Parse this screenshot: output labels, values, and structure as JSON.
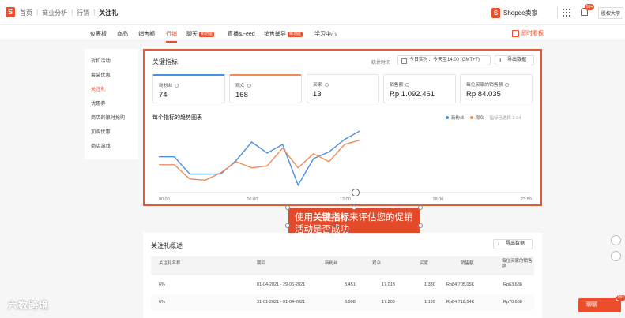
{
  "header": {
    "logo": "S",
    "breadcrumbs": [
      "首页",
      "商业分析",
      "行销",
      "关注礼"
    ],
    "brand": "Shopee卖家",
    "bell_badge": "99+",
    "user": "股权大学"
  },
  "nav": {
    "tabs": [
      {
        "label": "仪表板"
      },
      {
        "label": "商品"
      },
      {
        "label": "销售额"
      },
      {
        "label": "行销"
      },
      {
        "label": "聊天",
        "tag": "新功能"
      },
      {
        "label": "直播&Feed"
      },
      {
        "label": "销售辅导",
        "tag": "新功能"
      },
      {
        "label": "学习中心"
      }
    ],
    "promo_link": "即时看板"
  },
  "sidebar": {
    "items": [
      "折扣活动",
      "套装优惠",
      "关注礼",
      "优惠券",
      "商店的限时抢购",
      "加购优惠",
      "商店游戏"
    ],
    "active": "关注礼"
  },
  "key_panel": {
    "title": "关键指标",
    "stat_time_label": "统计时间",
    "date_range": "今日实时：今天至14:00 (GMT+7)",
    "export_label": "导出数据",
    "metrics": [
      {
        "label": "新粉丝",
        "value": "74"
      },
      {
        "label": "观众",
        "value": "168"
      },
      {
        "label": "买家",
        "value": "13"
      },
      {
        "label": "销售额",
        "value": "Rp 1.092.461"
      },
      {
        "label": "每位买家的销售额",
        "value": "Rp 84.035"
      }
    ],
    "chart_title": "每个指标的趋势图表",
    "legend_selected": "指标已选择 2 / 4",
    "colors": {
      "blue": "#4a8fe0",
      "orange": "#f08c5a",
      "accent": "#ee4d2d"
    }
  },
  "chart_data": {
    "type": "line",
    "x": [
      "00:00",
      "01:00",
      "02:00",
      "03:00",
      "04:00",
      "05:00",
      "06:00",
      "07:00",
      "08:00",
      "09:00",
      "10:00",
      "11:00",
      "12:00",
      "13:00",
      "14:00"
    ],
    "x_tick_labels": [
      "00:00",
      "06:00",
      "12:00",
      "18:00",
      "23:59"
    ],
    "series": [
      {
        "name": "新粉丝",
        "color": "#4a8fe0",
        "values": [
          58,
          58,
          30,
          30,
          30,
          52,
          82,
          64,
          78,
          12,
          55,
          66,
          86,
          100,
          null
        ]
      },
      {
        "name": "观众",
        "color": "#f08c5a",
        "values": [
          45,
          45,
          22,
          20,
          32,
          50,
          40,
          43,
          72,
          40,
          63,
          50,
          78,
          85,
          null
        ]
      }
    ],
    "ylim": [
      0,
      110
    ],
    "grid": true
  },
  "callout": {
    "prefix": "使用",
    "bold": "关键指标",
    "suffix": "来评估您的促销活动是否成功"
  },
  "overview": {
    "title": "关注礼概述",
    "export_label": "导出数据",
    "headers": [
      "关注礼名称",
      "期间",
      "新粉丝",
      "观众",
      "买家",
      "销售额",
      "每位买家的销售额"
    ],
    "rows": [
      [
        "6%",
        "01-04-2021 - 29-06-2021",
        "8.451",
        "17.018",
        "1.330",
        "Rp84.705,05K",
        "Rp63.688"
      ],
      [
        "6%",
        "31-01-2021 - 01-04-2021",
        "8.998",
        "17.209",
        "1.199",
        "Rp84.718,54K",
        "Rp70.658"
      ]
    ]
  },
  "footer": {
    "watermark": "六数跨境",
    "chat_label": "聊聊",
    "chat_badge": "99+"
  }
}
